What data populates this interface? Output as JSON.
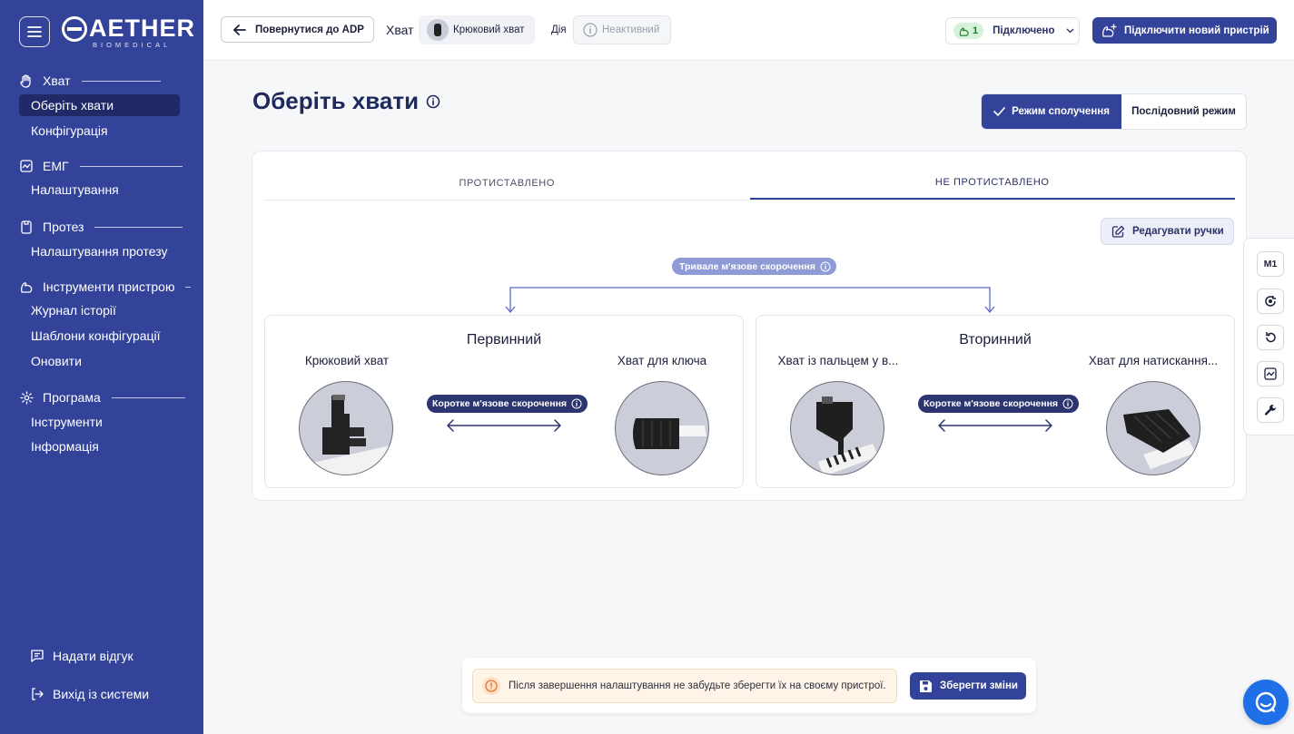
{
  "brand": {
    "name": "AETHER",
    "sub": "BIOMEDICAL"
  },
  "sidebar": {
    "sections": [
      {
        "title": "Хват",
        "icon": "hand-icon",
        "items": [
          "Оберіть хвати",
          "Конфігурація"
        ]
      },
      {
        "title": "ЕМГ",
        "icon": "chart-icon",
        "items": [
          "Налаштування"
        ]
      },
      {
        "title": "Протез",
        "icon": "device-icon",
        "items": [
          "Налаштування протезу"
        ]
      },
      {
        "title": "Інструменти пристрою",
        "icon": "arm-icon",
        "items": [
          "Журнал історії",
          "Шаблони конфігурації",
          "Оновити"
        ]
      },
      {
        "title": "Програма",
        "icon": "gear-icon",
        "items": [
          "Інструменти",
          "Інформація"
        ]
      }
    ],
    "feedback": "Надати відгук",
    "logout": "Вихід із системи"
  },
  "topbar": {
    "back_label": "Повернутися до ADP",
    "grip_label": "Хват",
    "grip_value": "Крюковий хват",
    "action_label": "Дія",
    "action_value": "Неактивний",
    "connection_count": "1",
    "connection_label": "Підключено",
    "new_device_label": "Підключити новий пристрій"
  },
  "page": {
    "title": "Оберіть хвати",
    "mode_combined": "Режим сполучення",
    "mode_sequential": "Послідовний режим"
  },
  "tabs": [
    "ПРОТИСТАВЛЕНО",
    "НЕ ПРОТИСТАВЛЕНО"
  ],
  "edit_handles": "Редагувати ручки",
  "long_contraction": "Тривале м'язове скорочення",
  "short_contraction": "Коротке м'язове скорочення",
  "primary": {
    "title": "Первинний",
    "left": "Крюковий хват",
    "right": "Хват для ключа"
  },
  "secondary": {
    "title": "Вторинний",
    "left": "Хват із пальцем у в...",
    "right": "Хват для натискання..."
  },
  "float_toolbar": {
    "m1": "M1"
  },
  "save_bar": {
    "note": "Після завершення налаштування не забудьте зберегти їх на своєму пристрої.",
    "save_label": "Зберегти зміни"
  },
  "colors": {
    "brand": "#33439a",
    "brand_dark": "#1f2a66",
    "pill_light": "#8f9bd6",
    "pill_dark": "#2d3570",
    "chat": "#1e6fe8"
  }
}
